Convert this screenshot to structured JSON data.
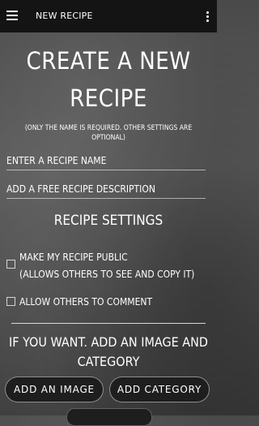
{
  "appbar": {
    "title": "NEW RECIPE",
    "menu_icon": "hamburger-menu-icon",
    "overflow_icon": "more-vert-icon"
  },
  "header": {
    "title_line1": "CREATE A NEW",
    "title_line2": "RECIPE",
    "note": "(ONLY THE NAME IS REQUIRED. OTHER SETTINGS ARE OPTIONAL)"
  },
  "form": {
    "name_placeholder": "ENTER A RECIPE NAME",
    "description_placeholder": "ADD A FREE RECIPE DESCRIPTION"
  },
  "settings": {
    "heading": "RECIPE SETTINGS",
    "public_label_line1": "MAKE MY RECIPE PUBLIC",
    "public_label_line2": "(ALLOWS OTHERS TO SEE AND COPY IT)",
    "public_checked": false,
    "comments_label": "ALLOW OTHERS TO COMMENT",
    "comments_checked": false
  },
  "extras": {
    "info_line1": "IF YOU WANT. ADD AN IMAGE AND",
    "info_line2": "CATEGORY",
    "add_image_label": "ADD AN IMAGE",
    "add_category_label": "ADD CATEGORY"
  },
  "colors": {
    "appbar": "#141414",
    "button": "#1e1e1e",
    "text": "#ffffff"
  }
}
